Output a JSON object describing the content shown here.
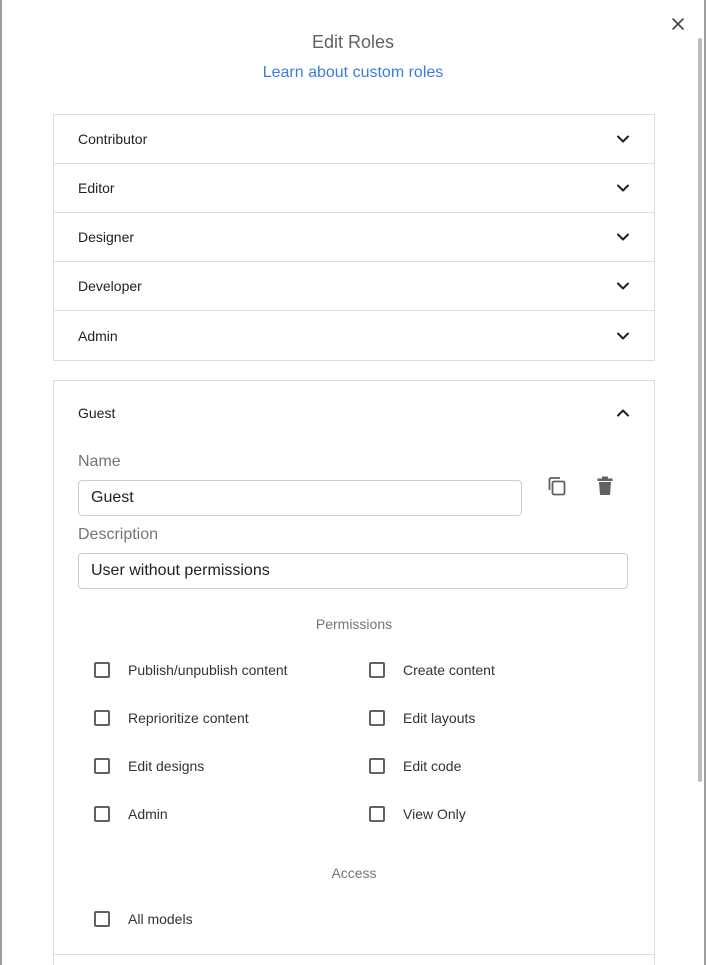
{
  "dialog": {
    "title": "Edit Roles",
    "learn_link": "Learn about custom roles",
    "close_icon": "close-icon",
    "link_color": "#3b7ddd"
  },
  "roles": [
    {
      "label": "Contributor",
      "expanded": false
    },
    {
      "label": "Editor",
      "expanded": false
    },
    {
      "label": "Designer",
      "expanded": false
    },
    {
      "label": "Developer",
      "expanded": false
    },
    {
      "label": "Admin",
      "expanded": false
    }
  ],
  "guest": {
    "label": "Guest",
    "expanded": true,
    "name_label": "Name",
    "name_value": "Guest",
    "description_label": "Description",
    "description_value": "User without permissions",
    "copy_icon": "copy-icon",
    "delete_icon": "trash-icon",
    "permissions_heading": "Permissions",
    "permissions": [
      {
        "label": "Publish/unpublish content",
        "checked": false
      },
      {
        "label": "Create content",
        "checked": false
      },
      {
        "label": "Reprioritize content",
        "checked": false
      },
      {
        "label": "Edit layouts",
        "checked": false
      },
      {
        "label": "Edit designs",
        "checked": false
      },
      {
        "label": "Edit code",
        "checked": false
      },
      {
        "label": "Admin",
        "checked": false
      },
      {
        "label": "View Only",
        "checked": false
      }
    ],
    "access_heading": "Access",
    "access": [
      {
        "label": "All models",
        "checked": false
      }
    ]
  }
}
